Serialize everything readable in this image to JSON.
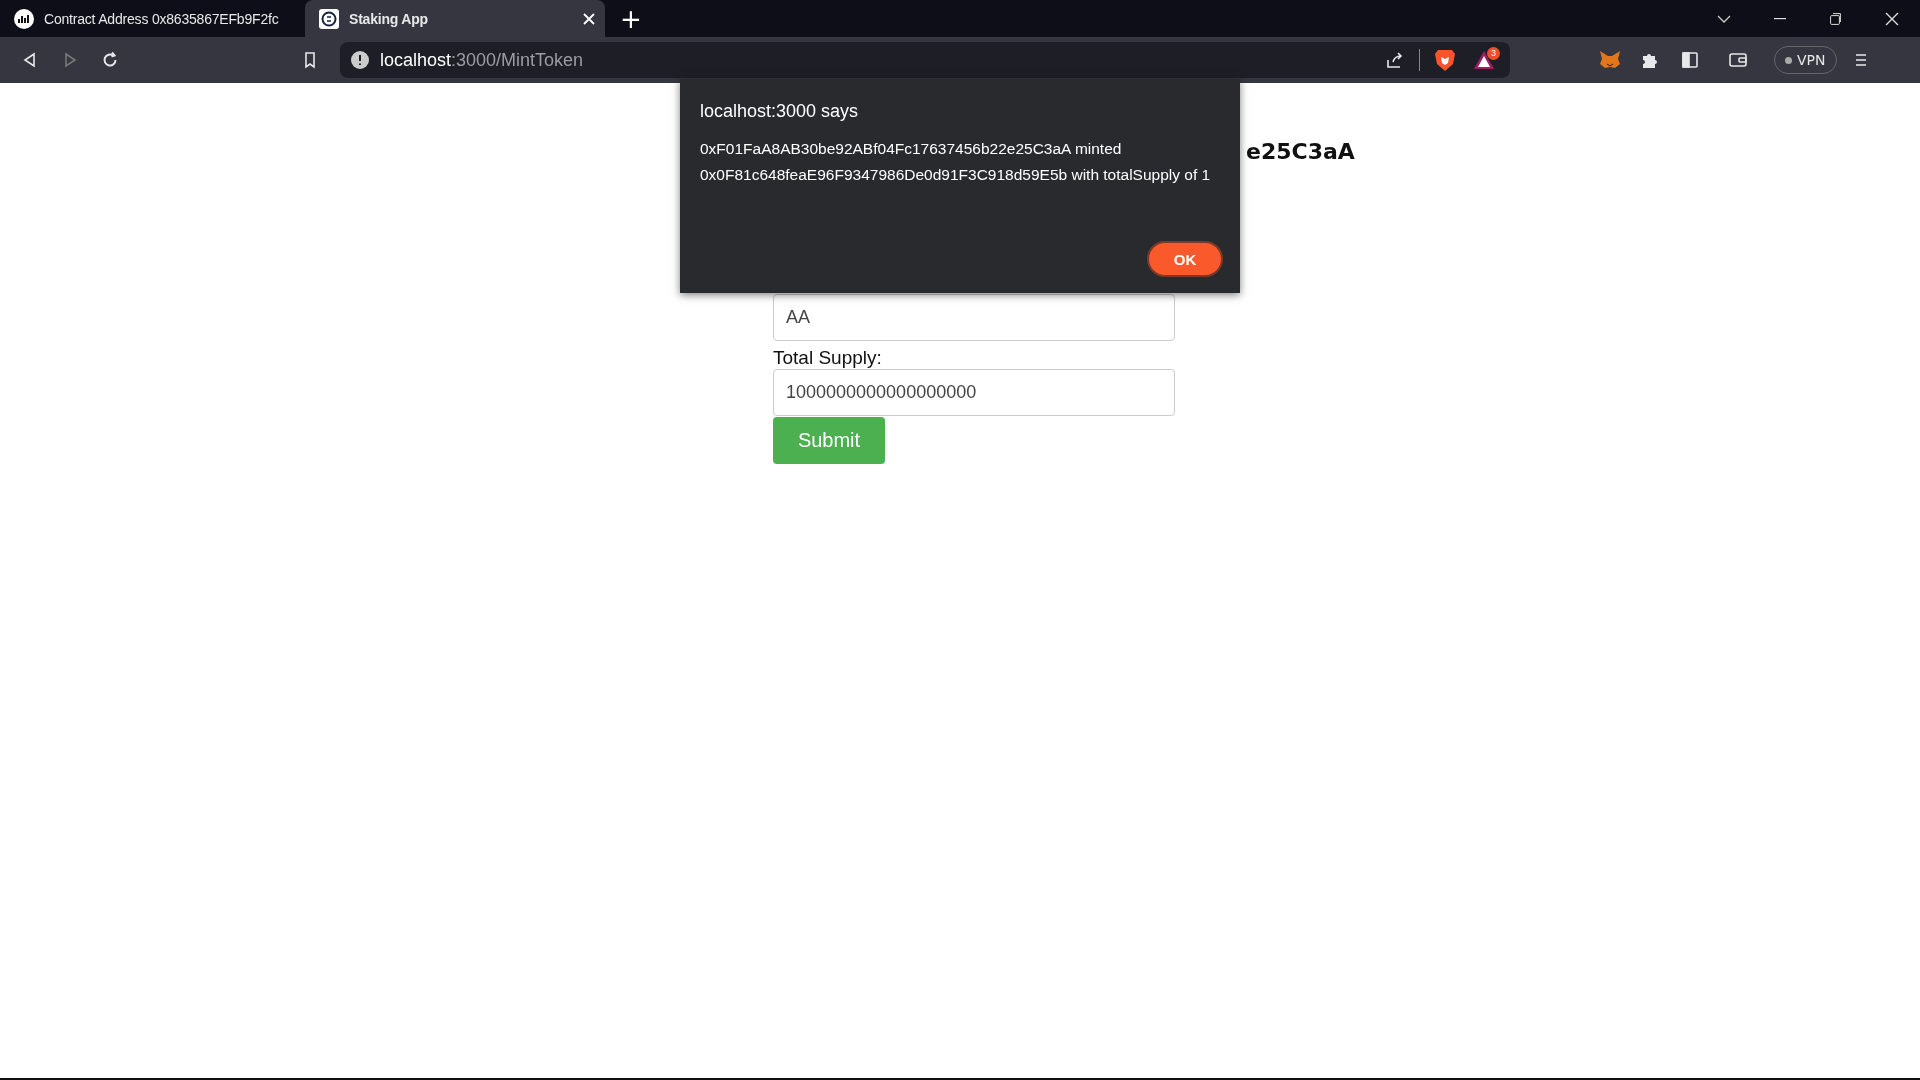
{
  "browser": {
    "tabs": [
      {
        "title": "Contract Address 0x8635867EFb9F2fc",
        "selected": false
      },
      {
        "title": "Staking App",
        "selected": true
      }
    ],
    "new_tab": "+",
    "address": {
      "host": "localhost",
      "path": ":3000/MintToken"
    },
    "rewards_badge": "3",
    "vpn": "VPN"
  },
  "page": {
    "heading_fragment": "e25C3aA",
    "fields": [
      {
        "value": "AA"
      },
      {
        "label": "Total Supply:",
        "value": "1000000000000000000"
      }
    ],
    "submit": "Submit"
  },
  "dialog": {
    "title": "localhost:3000 says",
    "message_lines": [
      "0xF01FaA8AB30be92ABf04Fc17637456b22e25C3aA minted",
      "0x0F81c648feaE96F9347986De0d91F3C918d59E5b with totalSupply of 1"
    ],
    "button": "OK"
  }
}
